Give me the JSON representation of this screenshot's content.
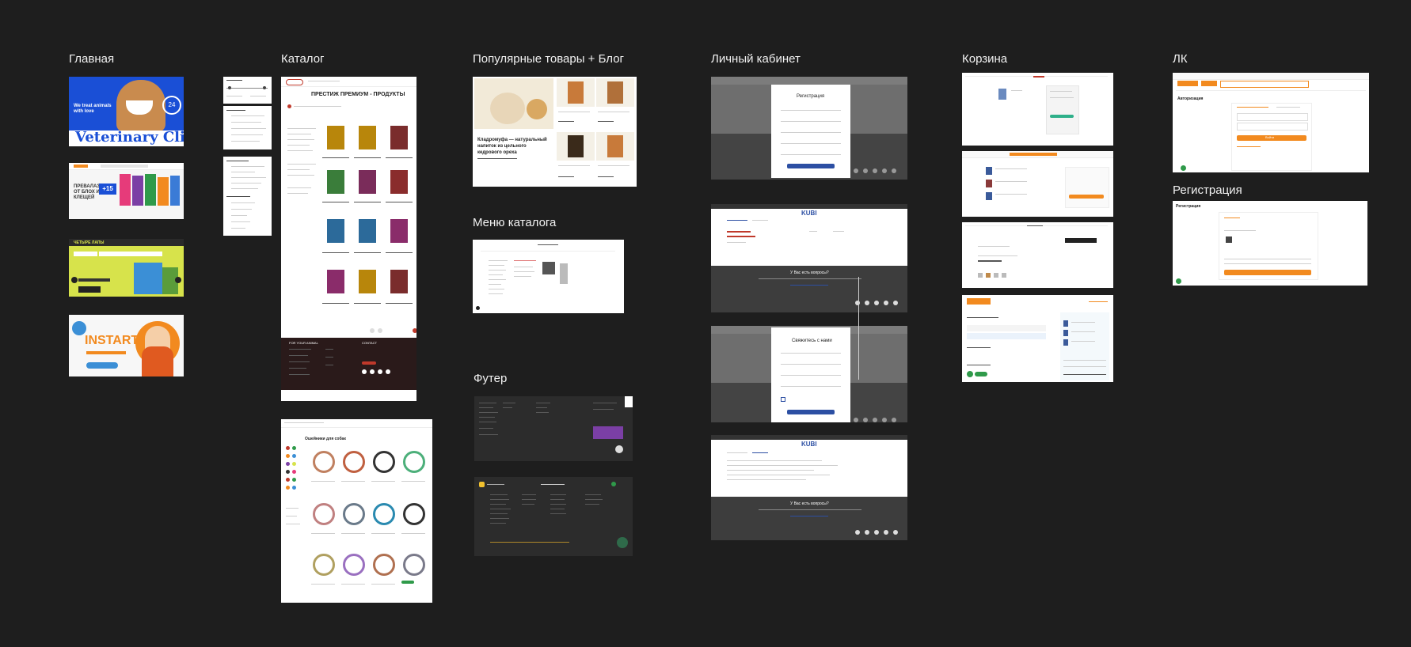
{
  "canvas": {
    "background": "#1e1e1e"
  },
  "sections": {
    "home": "Главная",
    "catalog": "Каталог",
    "popular": "Популярные товары + Блог",
    "catalog_menu": "Меню каталога",
    "footer": "Футер",
    "account": "Личный кабинет",
    "cart": "Корзина",
    "lk": "ЛК",
    "registration": "Регистрация"
  },
  "banners": {
    "vet_tagline": "We treat animals with love",
    "vet_title": "Veterinary Clinic",
    "vet_badge": "24",
    "promo_badge": "+15",
    "promo_text": "ПРЕВАЛАЗЫ ОТ БЛОХ И КЛЕЩЕЙ",
    "cat_brand": "ЧЕТЫРЕ ЛАПЫ",
    "instart": "INSTART"
  },
  "catalog_page": {
    "heading": "ПРЕСТИЖ ПРЕМИУМ - ПРОДУКТЫ",
    "footer_col1": "FOR YOUR ANIMAL",
    "footer_col2": "CONTACT"
  },
  "collars_page": {
    "heading": "Ошейники для собак"
  },
  "blog": {
    "title": "Кладромуфа — натуральный напиток из цельного кедрового ореха"
  },
  "account_screens": {
    "registration_title": "Регистрация",
    "brand": "KUBI",
    "questions": "У Вас есть вопросы?",
    "contact_title": "Свяжитесь с нами"
  },
  "lk_screen": {
    "auth_title": "Авторизация",
    "reg_title": "Регистрация",
    "submit": "Войти"
  },
  "colors": {
    "vet_blue": "#1a4fd6",
    "orange": "#f28a1f",
    "lime": "#d7e34b",
    "kubi_blue": "#2c4fa3",
    "green": "#2f9a4a",
    "purple": "#7b3fa5"
  }
}
